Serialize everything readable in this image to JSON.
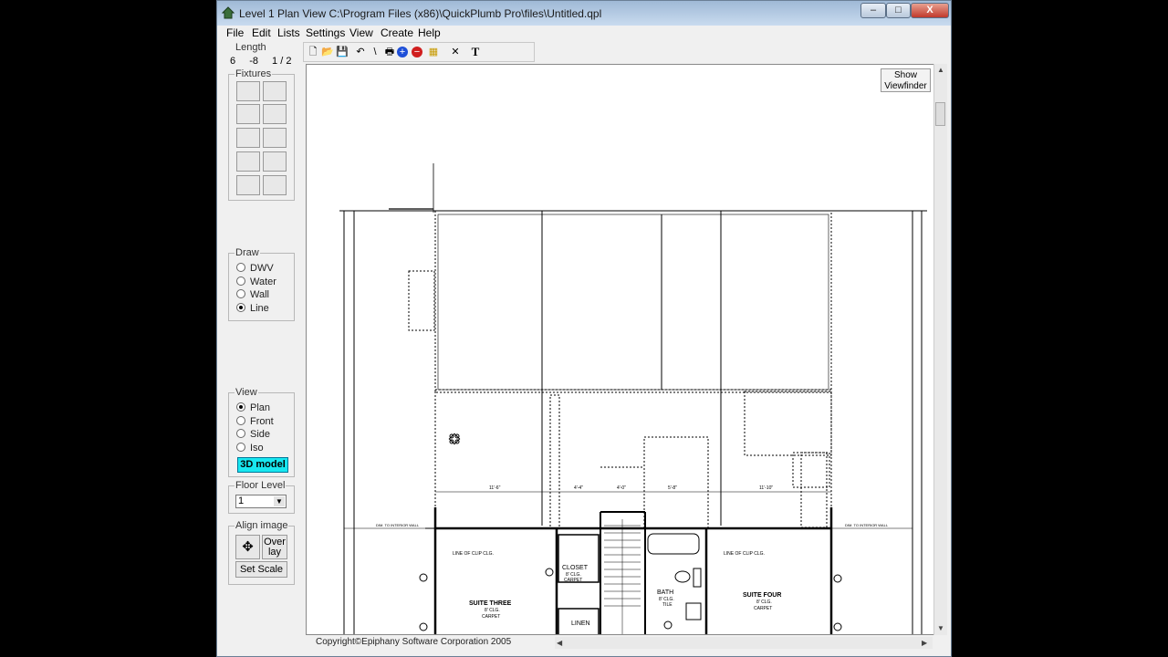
{
  "window": {
    "title": "Level 1 Plan View  C:\\Program Files (x86)\\QuickPlumb Pro\\files\\Untitled.qpl",
    "min_label": "–",
    "max_label": "□",
    "close_label": "X"
  },
  "menu": [
    "File",
    "Edit",
    "Lists",
    "Settings",
    "View",
    "Create",
    "Help"
  ],
  "toolbar": {
    "new": "🗋",
    "open": "📂",
    "save": "💾",
    "undo": "↶",
    "line": "\\",
    "print": "🖶",
    "zoom_in": "+",
    "zoom_out": "−",
    "color": "▦",
    "delete": "✕",
    "text": "T"
  },
  "length": {
    "label": "Length",
    "feet": "6",
    "inches": "-8",
    "fraction": "1 / 2"
  },
  "fixtures": {
    "label": "Fixtures"
  },
  "draw": {
    "label": "Draw",
    "options": [
      "DWV",
      "Water",
      "Wall",
      "Line"
    ],
    "selected": "Line"
  },
  "view": {
    "label": "View",
    "options": [
      "Plan",
      "Front",
      "Side",
      "Iso"
    ],
    "selected": "Plan",
    "model_button": "3D model"
  },
  "floor_level": {
    "label": "Floor Level",
    "value": "1"
  },
  "align_image": {
    "label": "Align image",
    "overlay": "Over lay",
    "set_scale": "Set Scale"
  },
  "viewfinder": {
    "line1": "Show",
    "line2": "Viewfinder"
  },
  "plan_labels": {
    "suite_three": "SUITE THREE",
    "suite_three_sub": "8' CLG.",
    "suite_three_floor": "CARPET",
    "suite_four": "SUITE FOUR",
    "suite_four_sub": "8' CLG.",
    "suite_four_floor": "CARPET",
    "closet": "CLOSET",
    "closet_sub": "8' CLG.",
    "closet_floor": "CARPET",
    "bath": "BATH",
    "bath_sub": "8' CLG.",
    "bath_floor": "TILE",
    "linen": "LINEN",
    "line_left": "LINE OF CLIP CLG.",
    "line_right": "LINE OF CLIP CLG.",
    "int_wall_left": "DIM. TO INTERIOR WALL",
    "int_wall_right": "DIM. TO INTERIOR WALL",
    "dim_a": "11'-6\"",
    "dim_b": "4'-4\"",
    "dim_c": "4'-0\"",
    "dim_d": "5'-8\"",
    "dim_e": "11'-10\""
  },
  "status": {
    "copyright": "Copyright©Epiphany Software Corporation 2005"
  },
  "colors": {
    "model_button": "#18e7f0",
    "titlebar": "#b4cbe6"
  }
}
